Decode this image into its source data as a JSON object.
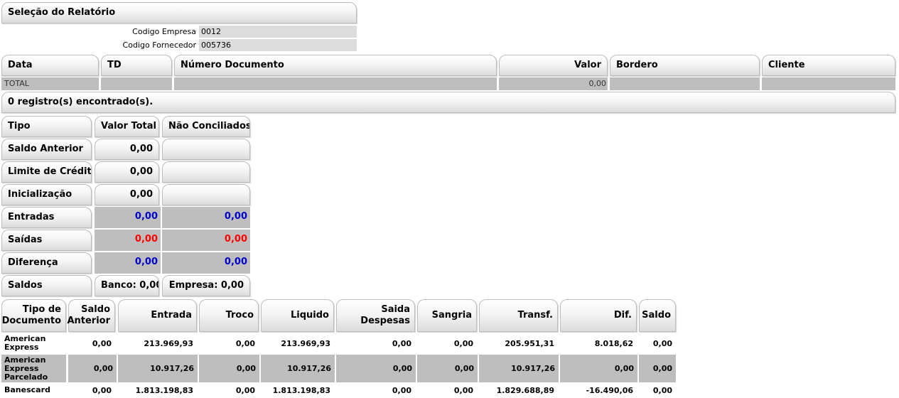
{
  "selection": {
    "title": "Seleção do Relatório",
    "empresa_label": "Codigo Empresa",
    "empresa_value": "0012",
    "fornecedor_label": "Codigo Fornecedor",
    "fornecedor_value": "005736"
  },
  "doc_table": {
    "headers": [
      "Data",
      "TD",
      "Número Documento",
      "Valor",
      "Bordero",
      "Cliente"
    ],
    "total_label": "TOTAL",
    "total_value": "0,00",
    "records_text": "0 registro(s) encontrado(s)."
  },
  "summary": {
    "headers": [
      "Tipo",
      "Valor Total",
      "Não Conciliados"
    ],
    "rows": [
      {
        "label": "Saldo Anterior",
        "total": "0,00",
        "nc": ""
      },
      {
        "label": "Limite de Crédito",
        "total": "0,00",
        "nc": ""
      },
      {
        "label": "Inicialização",
        "total": "0,00",
        "nc": ""
      },
      {
        "label": "Entradas",
        "total": "0,00",
        "nc": "0,00"
      },
      {
        "label": "Saídas",
        "total": "0,00",
        "nc": "0,00"
      },
      {
        "label": "Diferença",
        "total": "0,00",
        "nc": "0,00"
      },
      {
        "label": "Saldos",
        "total": "Banco: 0,00",
        "nc": "Empresa: 0,00"
      }
    ],
    "colors": {
      "blue": "#0000c8",
      "red": "#ff0000"
    }
  },
  "movement": {
    "headers": [
      "Tipo de Documento",
      "Saldo Anterior",
      "Entrada",
      "Troco",
      "Liquido",
      "Saida Despesas",
      "Sangria",
      "Transf.",
      "Dif.",
      "Saldo"
    ],
    "rows": [
      [
        "American Express",
        "0,00",
        "213.969,93",
        "0,00",
        "213.969,93",
        "0,00",
        "0,00",
        "205.951,31",
        "8.018,62",
        "0,00"
      ],
      [
        "American Express Parcelado",
        "0,00",
        "10.917,26",
        "0,00",
        "10.917,26",
        "0,00",
        "0,00",
        "10.917,26",
        "0,00",
        "0,00"
      ],
      [
        "Banescard",
        "0,00",
        "1.813.198,83",
        "0,00",
        "1.813.198,83",
        "0,00",
        "0,00",
        "1.829.688,89",
        "-16.490,06",
        "0,00"
      ]
    ]
  }
}
